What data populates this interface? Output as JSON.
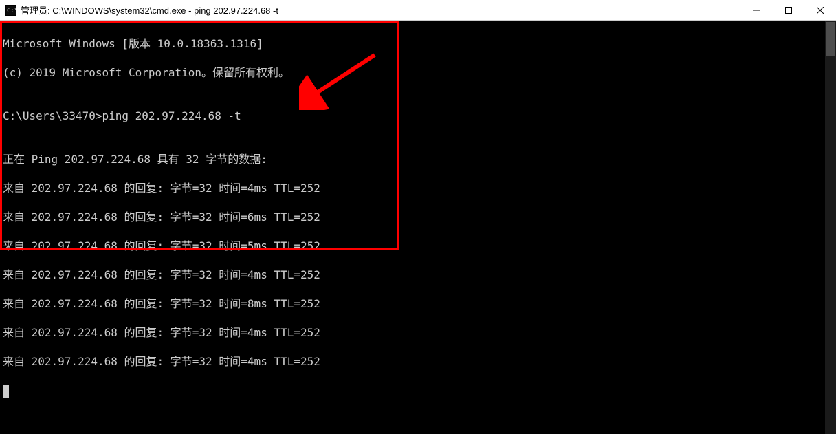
{
  "titlebar": {
    "title": "管理员: C:\\WINDOWS\\system32\\cmd.exe - ping  202.97.224.68 -t"
  },
  "terminal": {
    "line1": "Microsoft Windows [版本 10.0.18363.1316]",
    "line2": "(c) 2019 Microsoft Corporation。保留所有权利。",
    "line3": "",
    "line4": "C:\\Users\\33470>ping 202.97.224.68 -t",
    "line5": "",
    "line6": "正在 Ping 202.97.224.68 具有 32 字节的数据:",
    "ping_replies": [
      "来自 202.97.224.68 的回复: 字节=32 时间=4ms TTL=252",
      "来自 202.97.224.68 的回复: 字节=32 时间=6ms TTL=252",
      "来自 202.97.224.68 的回复: 字节=32 时间=5ms TTL=252",
      "来自 202.97.224.68 的回复: 字节=32 时间=4ms TTL=252",
      "来自 202.97.224.68 的回复: 字节=32 时间=8ms TTL=252",
      "来自 202.97.224.68 的回复: 字节=32 时间=4ms TTL=252",
      "来自 202.97.224.68 的回复: 字节=32 时间=4ms TTL=252"
    ]
  }
}
